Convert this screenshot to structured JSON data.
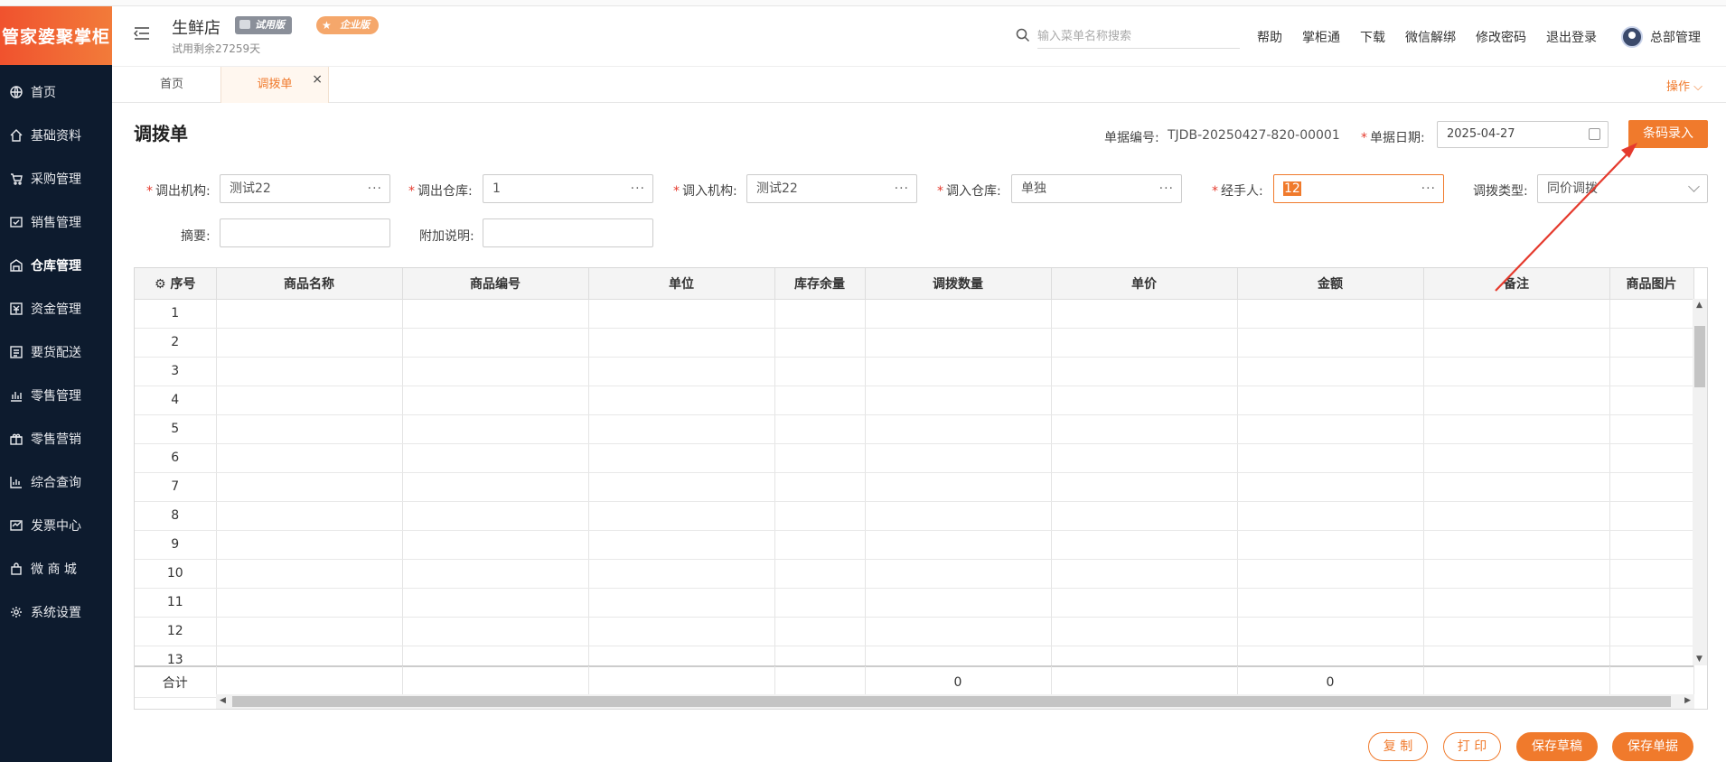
{
  "app": {
    "logo_text": "管家婆聚掌柜",
    "store_name": "生鲜店",
    "trial_badge": "试用版",
    "edition_badge": "企业版",
    "trial_remaining": "试用剩余27259天"
  },
  "sidebar": {
    "items": [
      {
        "label": "首页",
        "icon": "globe-icon"
      },
      {
        "label": "基础资料",
        "icon": "home-icon"
      },
      {
        "label": "采购管理",
        "icon": "cart-icon"
      },
      {
        "label": "销售管理",
        "icon": "sales-icon"
      },
      {
        "label": "仓库管理",
        "icon": "warehouse-icon"
      },
      {
        "label": "资金管理",
        "icon": "money-icon"
      },
      {
        "label": "要货配送",
        "icon": "delivery-icon"
      },
      {
        "label": "零售管理",
        "icon": "chart-icon"
      },
      {
        "label": "零售营销",
        "icon": "gift-icon"
      },
      {
        "label": "综合查询",
        "icon": "stats-icon"
      },
      {
        "label": "发票中心",
        "icon": "invoice-icon"
      },
      {
        "label": "微 商 城",
        "icon": "shop-icon"
      },
      {
        "label": "系统设置",
        "icon": "gear-icon"
      }
    ],
    "active_index": 4
  },
  "header": {
    "search_placeholder": "输入菜单名称搜索",
    "menu": [
      "帮助",
      "掌柜通",
      "下载",
      "微信解绑",
      "修改密码",
      "退出登录"
    ],
    "user_name": "总部管理"
  },
  "tabs": {
    "home": "首页",
    "active": "调拨单",
    "close": "×",
    "operations": "操作 ⌵"
  },
  "form": {
    "title": "调拨单",
    "doc_no_label": "单据编号:",
    "doc_no": "TJDB-20250427-820-00001",
    "date_label": "单据日期:",
    "date": "2025-04-27",
    "barcode_button": "条码录入",
    "out_org_label": "调出机构:",
    "out_org": "测试22",
    "out_wh_label": "调出仓库:",
    "out_wh": "1",
    "in_org_label": "调入机构:",
    "in_org": "测试22",
    "in_wh_label": "调入仓库:",
    "in_wh": "单独",
    "handler_label": "经手人:",
    "handler": "12",
    "type_label": "调拨类型:",
    "type": "同价调拨",
    "summary_label": "摘要:",
    "summary": "",
    "extra_label": "附加说明:",
    "extra": "",
    "more_dots": "···"
  },
  "table": {
    "columns": [
      "序号",
      "商品名称",
      "商品编号",
      "单位",
      "库存余量",
      "调拨数量",
      "单价",
      "金额",
      "备注",
      "商品图片"
    ],
    "rows": [
      "1",
      "2",
      "3",
      "4",
      "5",
      "6",
      "7",
      "8",
      "9",
      "10",
      "11",
      "12",
      "13"
    ],
    "total_label": "合计",
    "total_qty": "0",
    "total_amount": "0"
  },
  "footer": {
    "copy": "复 制",
    "print": "打 印",
    "save_draft": "保存草稿",
    "save": "保存单据"
  },
  "colors": {
    "accent": "#f07a2c",
    "sidebar_bg": "#0d1b2e",
    "required": "#e53a2d",
    "annotation": "#e53a2d"
  }
}
